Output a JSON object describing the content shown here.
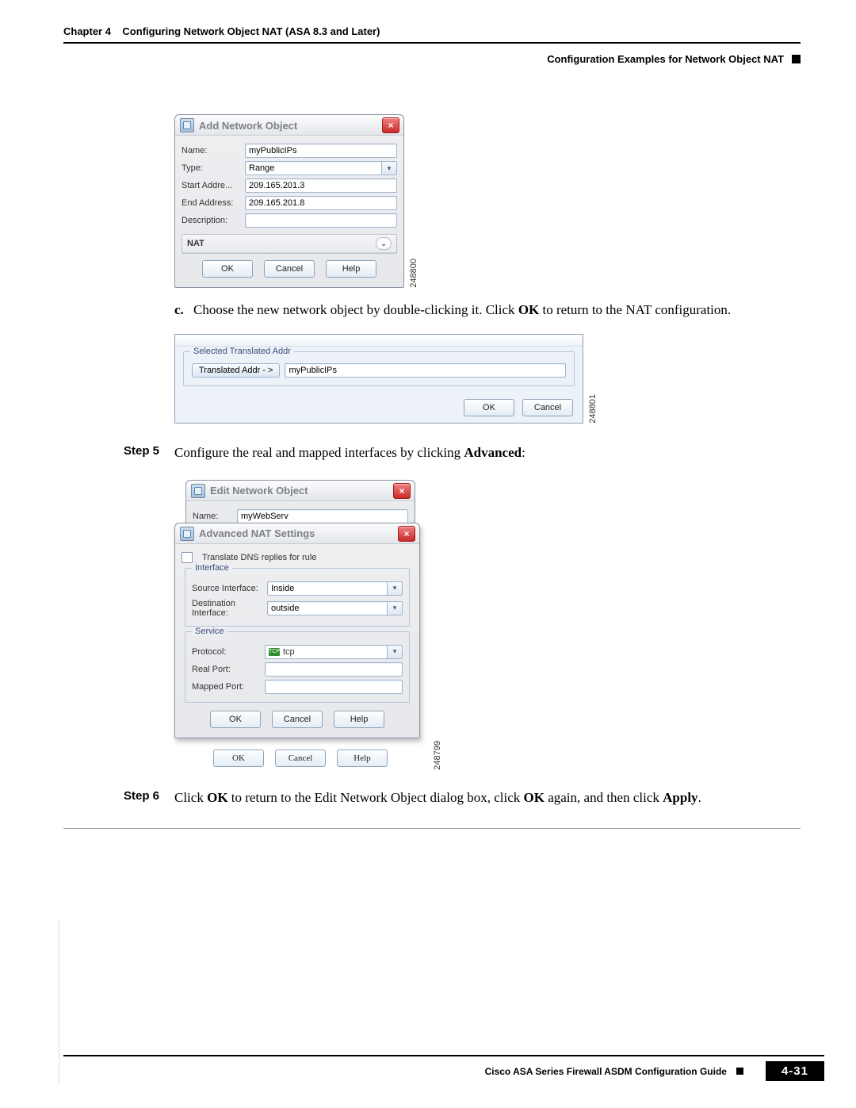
{
  "header": {
    "chapter_label": "Chapter 4",
    "chapter_title": "Configuring Network Object NAT (ASA 8.3 and Later)",
    "section_title": "Configuration Examples for Network Object NAT"
  },
  "sublist_c": {
    "label": "c.",
    "before_ok": "Choose the new network object by double-clicking it. Click ",
    "ok": "OK",
    "after_ok": " to return to the NAT configuration."
  },
  "step5": {
    "label": "Step 5",
    "before_adv": "Configure the real and mapped interfaces by clicking ",
    "adv": "Advanced",
    "after_adv": ":"
  },
  "step6": {
    "label": "Step 6",
    "t1": "Click ",
    "ok1": "OK",
    "t2": " to return to the Edit Network Object dialog box, click ",
    "ok2": "OK",
    "t3": " again, and then click ",
    "apply": "Apply",
    "t4": "."
  },
  "dialog1": {
    "title": "Add Network Object",
    "fields": {
      "name_label": "Name:",
      "name_value": "myPublicIPs",
      "type_label": "Type:",
      "type_value": "Range",
      "start_label": "Start Addre...",
      "start_value": "209.165.201.3",
      "end_label": "End Address:",
      "end_value": "209.165.201.8",
      "desc_label": "Description:",
      "desc_value": ""
    },
    "nat_group": "NAT",
    "buttons": {
      "ok": "OK",
      "cancel": "Cancel",
      "help": "Help"
    },
    "img_id": "248800"
  },
  "dialog2": {
    "fieldset_title": "Selected Translated Addr",
    "btn_label": "Translated Addr - >",
    "value": "myPublicIPs",
    "buttons": {
      "ok": "OK",
      "cancel": "Cancel"
    },
    "img_id": "248801"
  },
  "dialog3_behind": {
    "title": "Edit Network Object",
    "name_label": "Name:",
    "name_value": "myWebServ"
  },
  "dialog3": {
    "title": "Advanced NAT Settings",
    "chk_label": "Translate DNS replies for rule",
    "interface_group": "Interface",
    "src_label": "Source Interface:",
    "src_value": "Inside",
    "dst_label": "Destination Interface:",
    "dst_value": "outside",
    "service_group": "Service",
    "proto_label": "Protocol:",
    "proto_value": "tcp",
    "real_label": "Real Port:",
    "mapped_label": "Mapped Port:",
    "buttons": {
      "ok": "OK",
      "cancel": "Cancel",
      "help": "Help"
    },
    "img_id": "248799"
  },
  "footer": {
    "book": "Cisco ASA Series Firewall ASDM Configuration Guide",
    "page": "4-31"
  }
}
